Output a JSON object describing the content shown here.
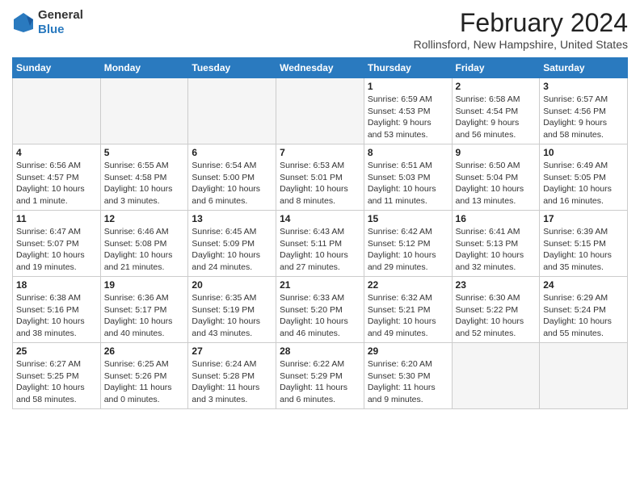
{
  "logo": {
    "general": "General",
    "blue": "Blue"
  },
  "header": {
    "month_year": "February 2024",
    "location": "Rollinsford, New Hampshire, United States"
  },
  "weekdays": [
    "Sunday",
    "Monday",
    "Tuesday",
    "Wednesday",
    "Thursday",
    "Friday",
    "Saturday"
  ],
  "weeks": [
    [
      {
        "day": "",
        "info": ""
      },
      {
        "day": "",
        "info": ""
      },
      {
        "day": "",
        "info": ""
      },
      {
        "day": "",
        "info": ""
      },
      {
        "day": "1",
        "info": "Sunrise: 6:59 AM\nSunset: 4:53 PM\nDaylight: 9 hours\nand 53 minutes."
      },
      {
        "day": "2",
        "info": "Sunrise: 6:58 AM\nSunset: 4:54 PM\nDaylight: 9 hours\nand 56 minutes."
      },
      {
        "day": "3",
        "info": "Sunrise: 6:57 AM\nSunset: 4:56 PM\nDaylight: 9 hours\nand 58 minutes."
      }
    ],
    [
      {
        "day": "4",
        "info": "Sunrise: 6:56 AM\nSunset: 4:57 PM\nDaylight: 10 hours\nand 1 minute."
      },
      {
        "day": "5",
        "info": "Sunrise: 6:55 AM\nSunset: 4:58 PM\nDaylight: 10 hours\nand 3 minutes."
      },
      {
        "day": "6",
        "info": "Sunrise: 6:54 AM\nSunset: 5:00 PM\nDaylight: 10 hours\nand 6 minutes."
      },
      {
        "day": "7",
        "info": "Sunrise: 6:53 AM\nSunset: 5:01 PM\nDaylight: 10 hours\nand 8 minutes."
      },
      {
        "day": "8",
        "info": "Sunrise: 6:51 AM\nSunset: 5:03 PM\nDaylight: 10 hours\nand 11 minutes."
      },
      {
        "day": "9",
        "info": "Sunrise: 6:50 AM\nSunset: 5:04 PM\nDaylight: 10 hours\nand 13 minutes."
      },
      {
        "day": "10",
        "info": "Sunrise: 6:49 AM\nSunset: 5:05 PM\nDaylight: 10 hours\nand 16 minutes."
      }
    ],
    [
      {
        "day": "11",
        "info": "Sunrise: 6:47 AM\nSunset: 5:07 PM\nDaylight: 10 hours\nand 19 minutes."
      },
      {
        "day": "12",
        "info": "Sunrise: 6:46 AM\nSunset: 5:08 PM\nDaylight: 10 hours\nand 21 minutes."
      },
      {
        "day": "13",
        "info": "Sunrise: 6:45 AM\nSunset: 5:09 PM\nDaylight: 10 hours\nand 24 minutes."
      },
      {
        "day": "14",
        "info": "Sunrise: 6:43 AM\nSunset: 5:11 PM\nDaylight: 10 hours\nand 27 minutes."
      },
      {
        "day": "15",
        "info": "Sunrise: 6:42 AM\nSunset: 5:12 PM\nDaylight: 10 hours\nand 29 minutes."
      },
      {
        "day": "16",
        "info": "Sunrise: 6:41 AM\nSunset: 5:13 PM\nDaylight: 10 hours\nand 32 minutes."
      },
      {
        "day": "17",
        "info": "Sunrise: 6:39 AM\nSunset: 5:15 PM\nDaylight: 10 hours\nand 35 minutes."
      }
    ],
    [
      {
        "day": "18",
        "info": "Sunrise: 6:38 AM\nSunset: 5:16 PM\nDaylight: 10 hours\nand 38 minutes."
      },
      {
        "day": "19",
        "info": "Sunrise: 6:36 AM\nSunset: 5:17 PM\nDaylight: 10 hours\nand 40 minutes."
      },
      {
        "day": "20",
        "info": "Sunrise: 6:35 AM\nSunset: 5:19 PM\nDaylight: 10 hours\nand 43 minutes."
      },
      {
        "day": "21",
        "info": "Sunrise: 6:33 AM\nSunset: 5:20 PM\nDaylight: 10 hours\nand 46 minutes."
      },
      {
        "day": "22",
        "info": "Sunrise: 6:32 AM\nSunset: 5:21 PM\nDaylight: 10 hours\nand 49 minutes."
      },
      {
        "day": "23",
        "info": "Sunrise: 6:30 AM\nSunset: 5:22 PM\nDaylight: 10 hours\nand 52 minutes."
      },
      {
        "day": "24",
        "info": "Sunrise: 6:29 AM\nSunset: 5:24 PM\nDaylight: 10 hours\nand 55 minutes."
      }
    ],
    [
      {
        "day": "25",
        "info": "Sunrise: 6:27 AM\nSunset: 5:25 PM\nDaylight: 10 hours\nand 58 minutes."
      },
      {
        "day": "26",
        "info": "Sunrise: 6:25 AM\nSunset: 5:26 PM\nDaylight: 11 hours\nand 0 minutes."
      },
      {
        "day": "27",
        "info": "Sunrise: 6:24 AM\nSunset: 5:28 PM\nDaylight: 11 hours\nand 3 minutes."
      },
      {
        "day": "28",
        "info": "Sunrise: 6:22 AM\nSunset: 5:29 PM\nDaylight: 11 hours\nand 6 minutes."
      },
      {
        "day": "29",
        "info": "Sunrise: 6:20 AM\nSunset: 5:30 PM\nDaylight: 11 hours\nand 9 minutes."
      },
      {
        "day": "",
        "info": ""
      },
      {
        "day": "",
        "info": ""
      }
    ]
  ]
}
